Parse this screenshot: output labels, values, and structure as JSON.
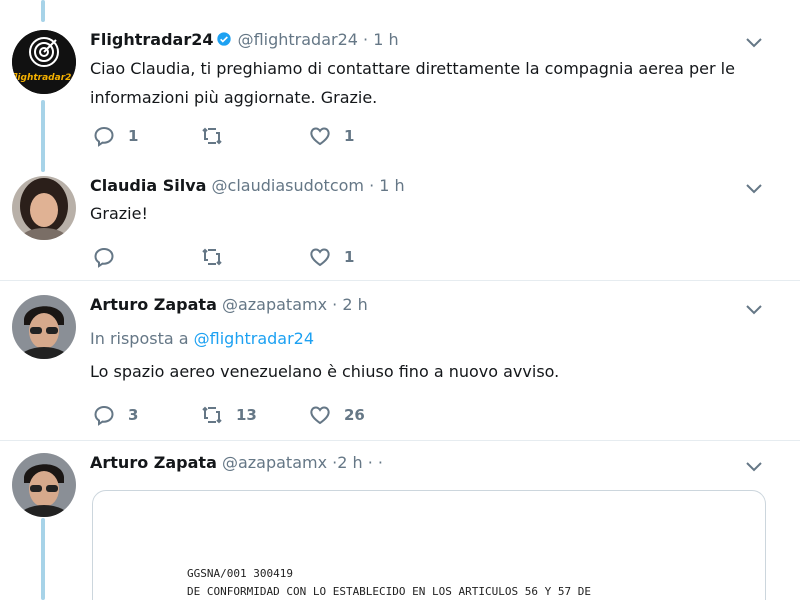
{
  "colors": {
    "accent": "#1da1f2",
    "thread_line": "#a7d3e8",
    "muted": "#657786",
    "like": "#e0245e",
    "retweet": "#17bf63"
  },
  "tweets": [
    {
      "name": "Flightradar24",
      "verified": true,
      "handle": "@flightradar24",
      "time": "1 h",
      "text_lines": [
        "Ciao Claudia, ti preghiamo di contattare direttamente la compagnia aerea per le",
        "informazioni più aggiornate. Grazie."
      ],
      "replies": "1",
      "retweets": "",
      "likes": "1",
      "avatar_logo_text": "flightradar24"
    },
    {
      "name": "Claudia Silva",
      "handle": "@claudiasudotcom",
      "time": "1 h",
      "text_lines": [
        "Grazie!"
      ],
      "replies": "",
      "retweets": "",
      "likes": "1"
    },
    {
      "name": "Arturo Zapata",
      "handle": "@azapatamx",
      "time": "2 h",
      "reply_prefix": "In risposta a",
      "reply_link": "@flightradar24",
      "text_lines": [
        "Lo spazio aereo venezuelano è chiuso fino a nuovo avviso."
      ],
      "replies": "3",
      "retweets": "13",
      "likes": "26"
    },
    {
      "name": "Arturo Zapata",
      "handle": "@azapatamx",
      "time": "2 h",
      "extra": "· ·",
      "document_lines": [
        "GGSNA/001 300419",
        "DE CONFORMIDAD CON LO ESTABLECIDO EN LOS ARTICULOS 56 Y 57 DE"
      ]
    }
  ]
}
